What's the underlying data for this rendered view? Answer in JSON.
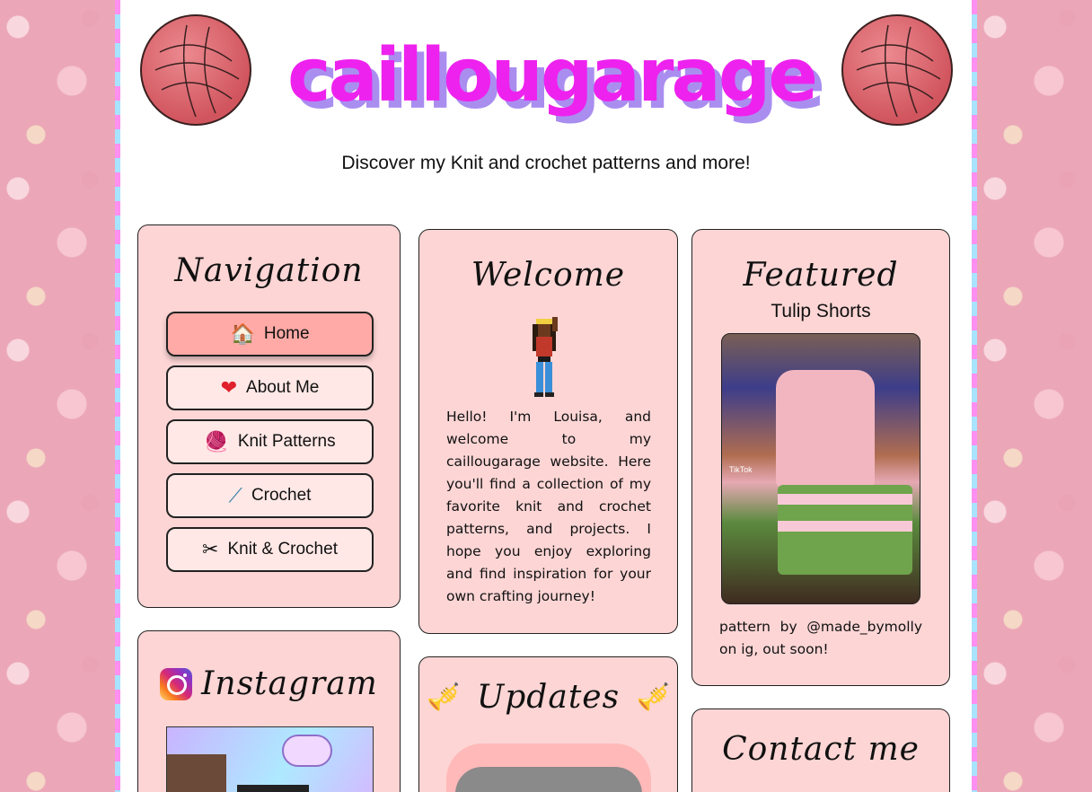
{
  "header": {
    "title": "caillougarage",
    "tagline": "Discover my Knit and crochet patterns and more!"
  },
  "navigation": {
    "title": "Navigation",
    "items": [
      {
        "label": "Home",
        "icon": "house-icon",
        "active": true
      },
      {
        "label": "About Me",
        "icon": "heart-icon",
        "active": false
      },
      {
        "label": "Knit Patterns",
        "icon": "knitting-icon",
        "active": false
      },
      {
        "label": "Crochet",
        "icon": "crochet-hook-icon",
        "active": false
      },
      {
        "label": "Knit & Crochet",
        "icon": "scissors-icon",
        "active": false
      }
    ]
  },
  "instagram": {
    "title": "Instagram"
  },
  "welcome": {
    "title": "Welcome",
    "text": "Hello! I'm Louisa, and welcome to my caillougarage website. Here you'll find a collection of my favorite knit and crochet patterns, and projects. I hope you enjoy exploring and find inspiration for your own crafting journey!"
  },
  "updates": {
    "title": "Updates"
  },
  "featured": {
    "title": "Featured",
    "subtitle": "Tulip Shorts",
    "image_tag": "TikTok",
    "credit": "pattern by @made_bymolly on ig, out soon!"
  },
  "contact": {
    "title": "Contact me"
  },
  "colors": {
    "title": "#ee22ee",
    "title_shadow": "#a98ef0",
    "card_bg": "#fdd5d5",
    "active_button": "#ffaaa6",
    "button_bg": "#ffe8e6"
  }
}
